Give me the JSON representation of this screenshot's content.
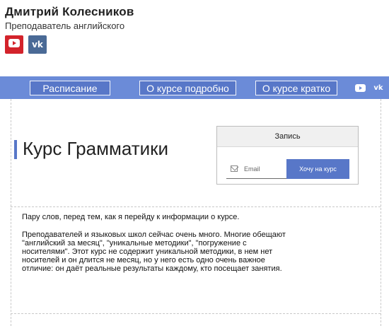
{
  "header": {
    "name": "Дмитрий Колесников",
    "role": "Преподаватель английского"
  },
  "social": [
    {
      "icon": "youtube-icon",
      "label": "",
      "color": "#d3232b"
    },
    {
      "icon": "vk-icon",
      "label": "vk",
      "color": "#4a6a96"
    }
  ],
  "nav": {
    "items": [
      "Расписание",
      "О курсе подробно",
      "О курсе кратко"
    ],
    "vk_label": "vk",
    "background": "#6b8bd8"
  },
  "main": {
    "title": "Курс Грамматики",
    "accent": "#5877c8",
    "paragraphs": [
      "Пару слов, перед тем, как я перейду к информации о курсе.",
      "Преподавателей и языковых школ сейчас очень много. Многие обещают \"английский за месяц\", \"уникальные методики\", \"погружение с носителями\". Этот курс не содержит уникальной методики, в нем нет носителей и он длится не месяц, но у него есть одно очень важное отличие: он даёт реальные результаты каждому, кто посещает занятия."
    ]
  },
  "signup": {
    "title": "Запись",
    "email_placeholder": "Email",
    "button_label": "Хочу на курс"
  }
}
